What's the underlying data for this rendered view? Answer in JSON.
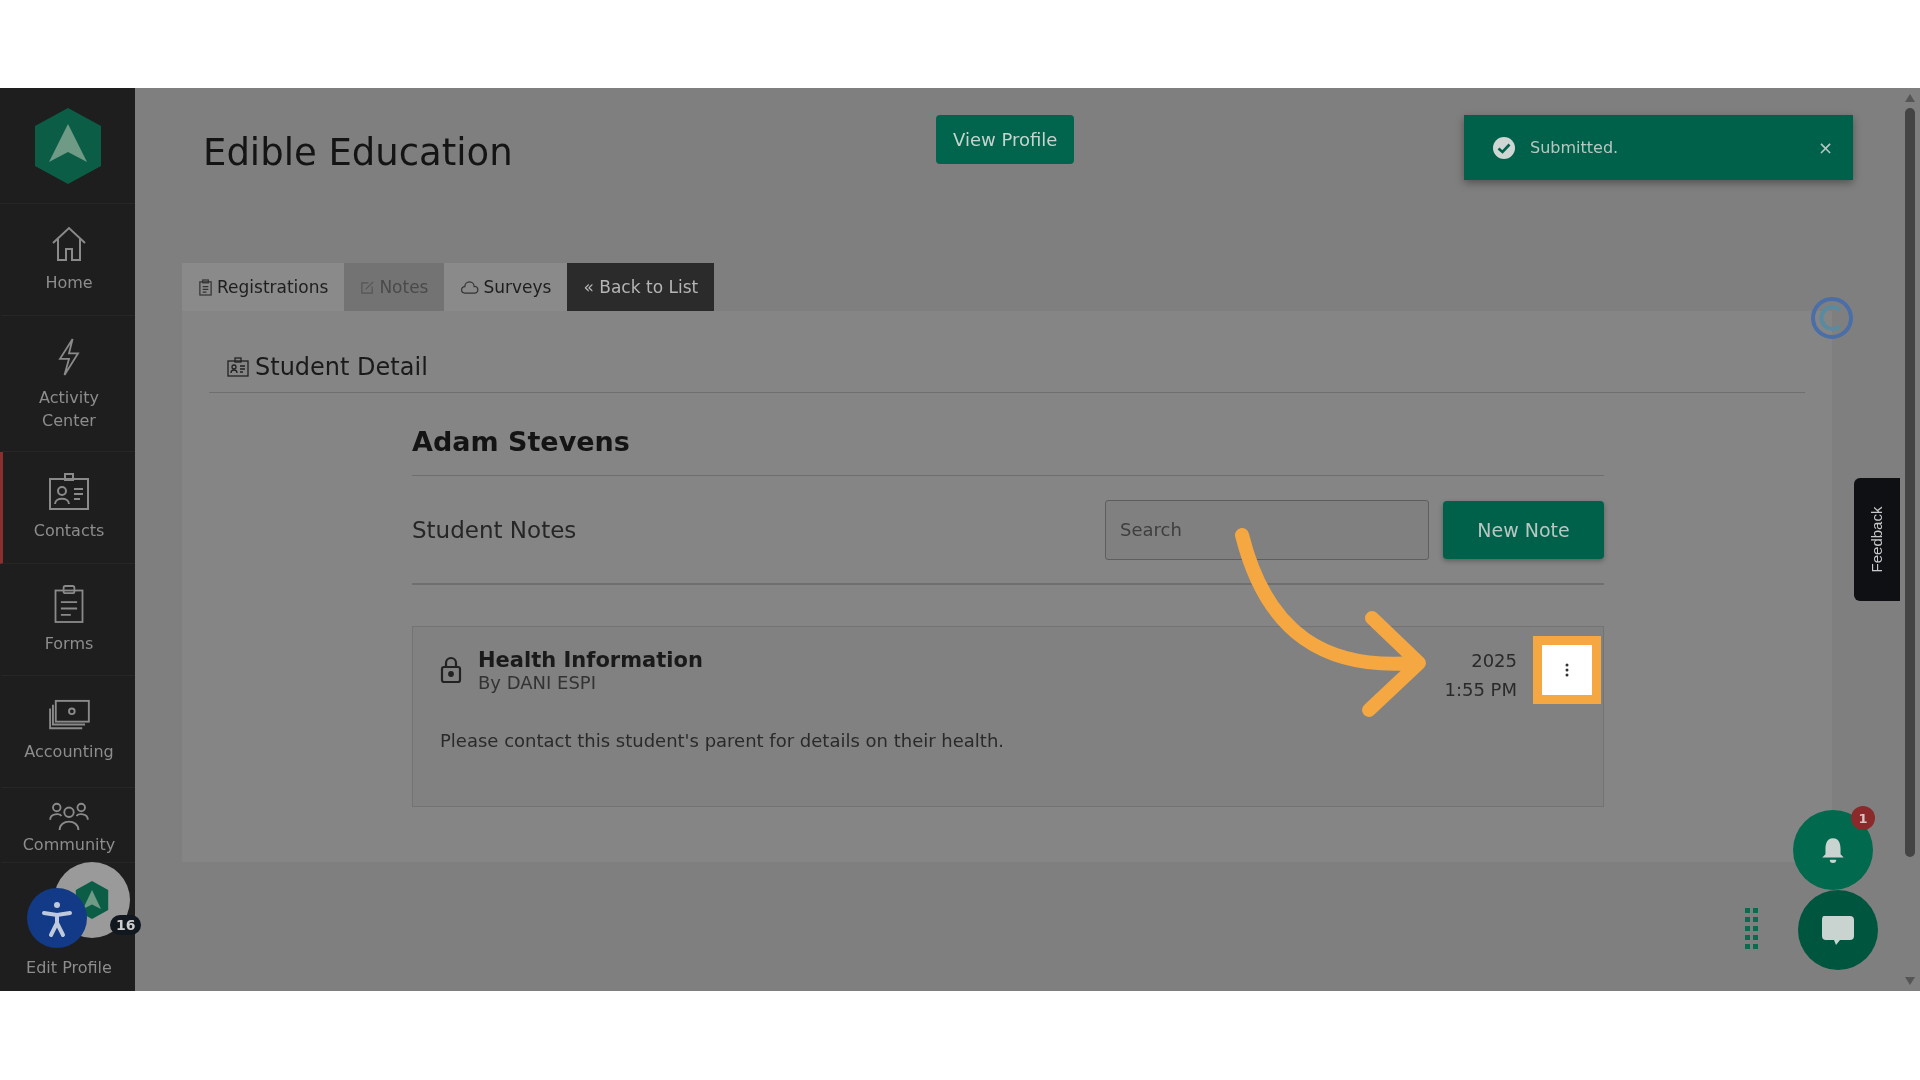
{
  "sidebar": {
    "items": [
      {
        "label": "Home",
        "selected": false
      },
      {
        "label": "Activity Center",
        "selected": false
      },
      {
        "label": "Contacts",
        "selected": true
      },
      {
        "label": "Forms",
        "selected": false
      },
      {
        "label": "Accounting",
        "selected": false
      },
      {
        "label": "Community",
        "selected": false
      },
      {
        "label": "Edit Profile",
        "selected": false
      }
    ],
    "avatar_badge": "16"
  },
  "header": {
    "title": "Edible Education",
    "view_profile": "View Profile"
  },
  "toast": {
    "message": "Submitted.",
    "close": "×"
  },
  "tabs": [
    {
      "label": "Registrations",
      "selected": false
    },
    {
      "label": "Notes",
      "selected": true
    },
    {
      "label": "Surveys",
      "selected": false
    }
  ],
  "back_link": "« Back to List",
  "section": {
    "title": "Student Detail"
  },
  "student": {
    "name": "Adam Stevens"
  },
  "notes": {
    "title": "Student Notes",
    "search": {
      "placeholder": "Search"
    },
    "new_button": "New Note",
    "items": [
      {
        "title": "Health Information",
        "author": "By DANI ESPI",
        "date": "2025",
        "time": "1:55 PM",
        "body": "Please contact this student's parent for details on their health.",
        "locked": true
      }
    ]
  },
  "feedback": "Feedback",
  "notifications": {
    "badge": "1"
  }
}
